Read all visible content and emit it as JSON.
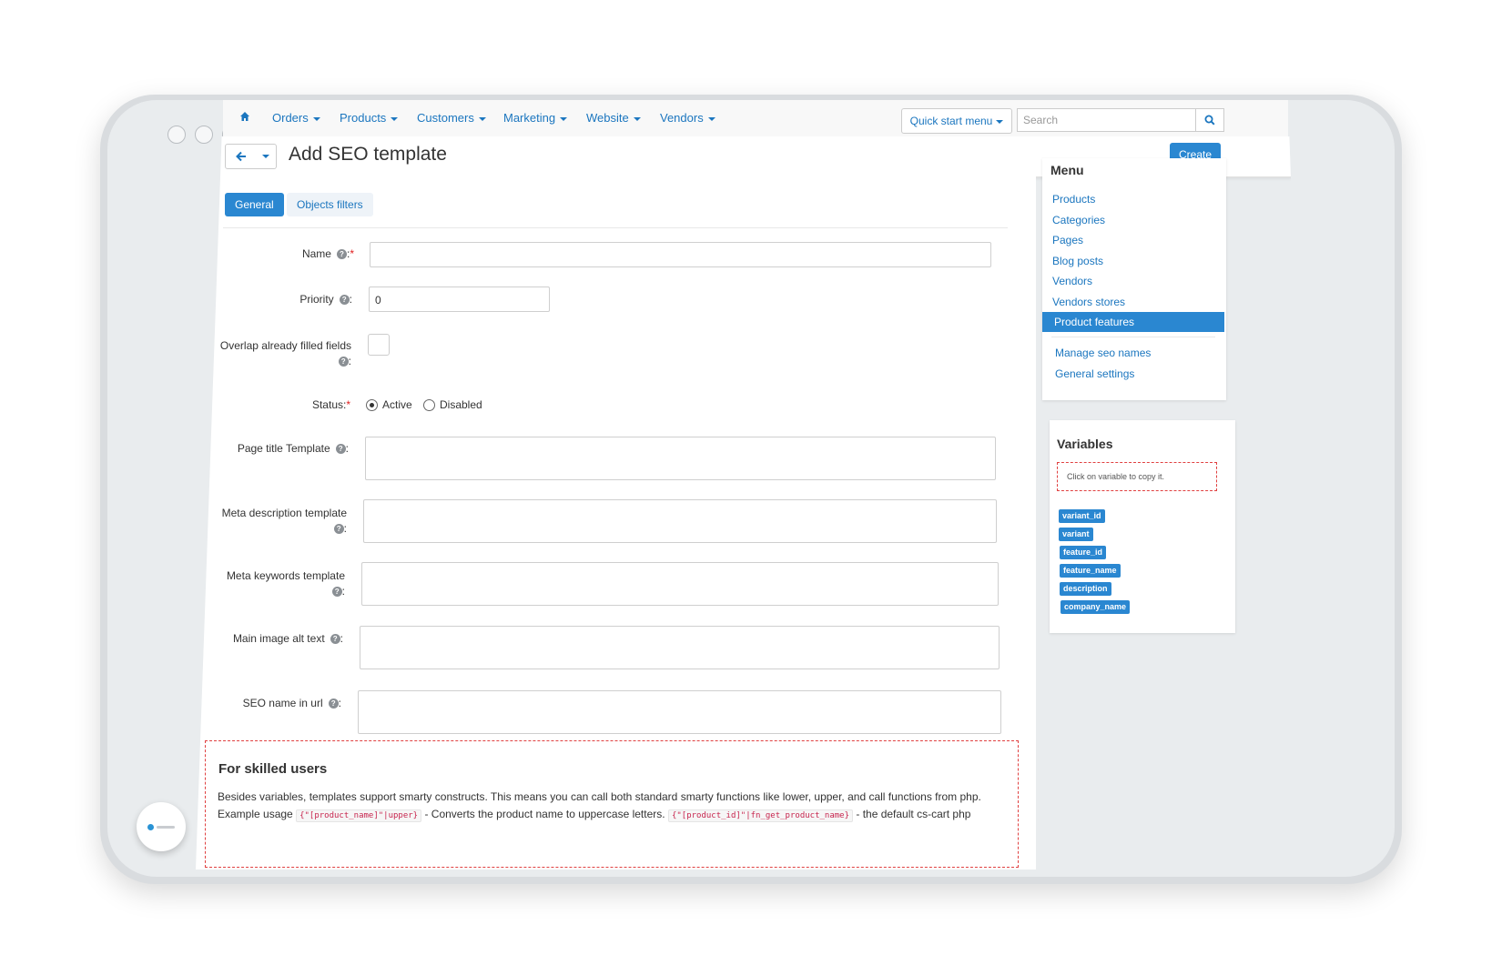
{
  "nav": {
    "items": [
      "Orders",
      "Products",
      "Customers",
      "Marketing",
      "Website",
      "Vendors"
    ],
    "quick_start": "Quick start menu",
    "search_placeholder": "Search"
  },
  "header": {
    "title": "Add SEO template",
    "create_label": "Create"
  },
  "tabs": [
    "General",
    "Objects filters"
  ],
  "form": {
    "name_label": "Name",
    "priority_label": "Priority",
    "priority_value": "0",
    "overlap_label": "Overlap already filled fields",
    "status_label": "Status:",
    "status_active": "Active",
    "status_disabled": "Disabled",
    "page_title_label": "Page title Template",
    "meta_desc_label": "Meta description template",
    "meta_keywords_label": "Meta keywords template",
    "image_alt_label": "Main image alt text",
    "seo_name_label": "SEO name in url"
  },
  "skilled": {
    "title": "For skilled users",
    "line1": "Besides variables, templates support smarty constructs. This means you can call both standard smarty functions like lower, upper, and call functions from php.",
    "example_prefix": "Example usage",
    "code1": "{\"[product_name]\"|upper}",
    "desc1": "- Converts the product name to uppercase letters.",
    "code2": "{\"[product_id]\"|fn_get_product_name}",
    "desc2": "- the default cs-cart php"
  },
  "sidebar": {
    "title": "Menu",
    "items": [
      "Products",
      "Categories",
      "Pages",
      "Blog posts",
      "Vendors",
      "Vendors stores"
    ],
    "active": "Product features",
    "extra": [
      "Manage seo names",
      "General settings"
    ]
  },
  "variables": {
    "title": "Variables",
    "hint": "Click on variable to copy it.",
    "tags": [
      "variant_id",
      "variant",
      "feature_id",
      "feature_name",
      "description",
      "company_name"
    ]
  },
  "colors": {
    "accent": "#2a87d1",
    "link": "#1b76bf",
    "required": "#e02020"
  }
}
